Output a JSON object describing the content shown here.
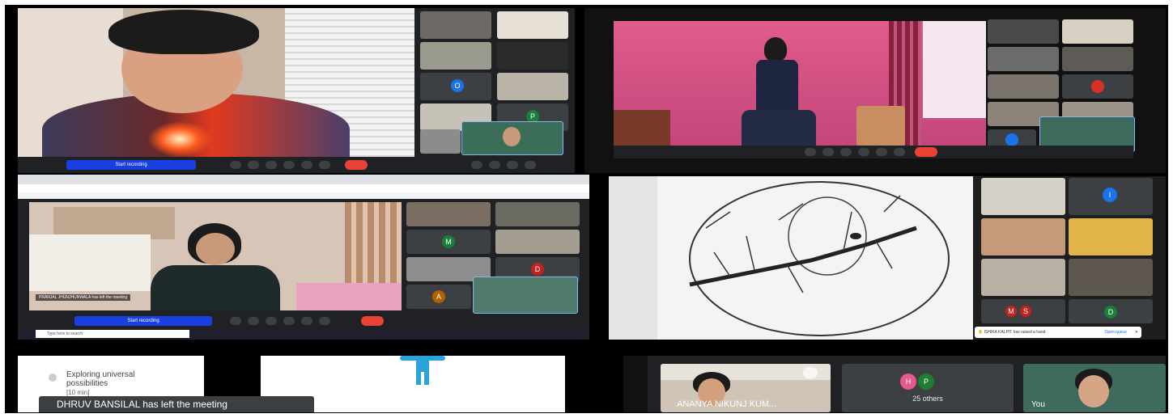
{
  "panels": {
    "top_left": {
      "record_label": "Start recording",
      "tile_avatar_letters": [
        "O",
        "P"
      ]
    },
    "middle_left": {
      "record_label": "Start recording",
      "toast": "PRANJAL JHUNJHUNWALA has left the meeting",
      "tile_avatar_letters": [
        "M",
        "D",
        "A"
      ],
      "search_placeholder": "Type here to search"
    },
    "middle_right": {
      "tile_avatar_letters": [
        "I",
        "M",
        "S",
        "D"
      ],
      "notification": "ISHIKA KALPIT has raised a hand",
      "open_queue": "Open queue"
    },
    "bottom_left": {
      "agenda_item": "Exploring universal possibilities",
      "agenda_duration": "[10 min]",
      "toast": "DHRUV BANSILAL has left the meeting"
    },
    "bottom_right": {
      "tile1_name": "ANANYA NIKUNJ KUM...",
      "others_avatars": [
        "H",
        "P"
      ],
      "others_count": "25 others",
      "tile3_name": "You"
    }
  },
  "colors": {
    "meet_dark": "#202124",
    "tile": "#3c4043",
    "end_call": "#ea4335",
    "record_button": "#1a3fe0",
    "avatar_blue": "#1a73e8",
    "avatar_green": "#188038",
    "avatar_red": "#d93025",
    "avatar_pink": "#c5221f"
  }
}
